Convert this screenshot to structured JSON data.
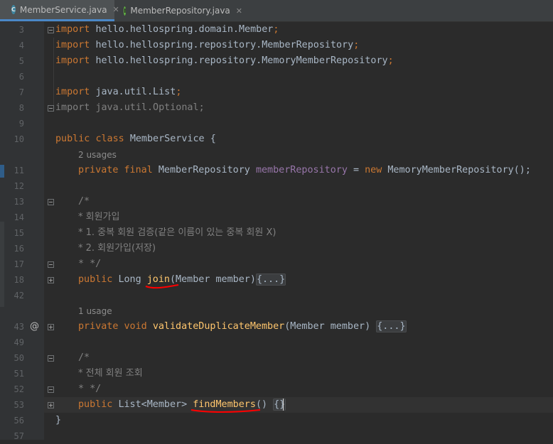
{
  "tabs": [
    {
      "label": "MemberService.java",
      "icon": "class-icon",
      "icon_letter": "C",
      "icon_color": "#3e86a0",
      "active": true
    },
    {
      "label": "MemberRepository.java",
      "icon": "interface-icon",
      "icon_letter": "I",
      "icon_color": "#62b543",
      "active": false
    }
  ],
  "close_glyph": "✕",
  "code_lines": [
    {
      "ln": "3",
      "text": "import hello.hellospring.domain.Member;"
    },
    {
      "ln": "4",
      "text": "import hello.hellospring.repository.MemberRepository;"
    },
    {
      "ln": "5",
      "text": "import hello.hellospring.repository.MemoryMemberRepository;"
    },
    {
      "ln": "6",
      "text": ""
    },
    {
      "ln": "7",
      "text": "import java.util.List;"
    },
    {
      "ln": "8",
      "text": "import java.util.Optional;"
    },
    {
      "ln": "9",
      "text": ""
    },
    {
      "ln": "10",
      "text": "public class MemberService {"
    },
    {
      "ln": "11",
      "text": "    private final MemberRepository memberRepository = new MemoryMemberRepository();",
      "hint": "2 usages"
    },
    {
      "ln": "12",
      "text": ""
    },
    {
      "ln": "13",
      "text": "    /*"
    },
    {
      "ln": "14",
      "text": "    * 회원가입"
    },
    {
      "ln": "15",
      "text": "    * 1. 중복 회원 검증(같은 이름이 있는 중복 회원 X)"
    },
    {
      "ln": "16",
      "text": "    * 2. 회원가입(저장)"
    },
    {
      "ln": "17",
      "text": "    * */"
    },
    {
      "ln": "18",
      "text": "    public Long join(Member member){...}"
    },
    {
      "ln": "42",
      "text": ""
    },
    {
      "ln": "43",
      "text": "    private void validateDuplicateMember(Member member) {...}",
      "hint": "1 usage",
      "gutter_mark": "@"
    },
    {
      "ln": "49",
      "text": ""
    },
    {
      "ln": "50",
      "text": "    /*"
    },
    {
      "ln": "51",
      "text": "    * 전체 회원 조회"
    },
    {
      "ln": "52",
      "text": "    * */"
    },
    {
      "ln": "53",
      "text": "    public List<Member> findMembers() {}"
    },
    {
      "ln": "56",
      "text": "}"
    },
    {
      "ln": "57",
      "text": ""
    }
  ],
  "tokens": {
    "kw_import": "import",
    "pkg_member": "hello.hellospring.domain.Member",
    "pkg_memberrepo": "hello.hellospring.repository.MemberRepository",
    "pkg_memoryrepo": "hello.hellospring.repository.MemoryMemberRepository",
    "pkg_list": "java.util.List",
    "pkg_optional": "java.util.Optional",
    "semi": ";",
    "kw_public": "public",
    "kw_class": "class",
    "cls_name": "MemberService",
    "open_brace": "{",
    "close_brace": "}",
    "kw_private": "private",
    "kw_final": "final",
    "type_memberrepo": "MemberRepository",
    "fld_name": "memberRepository",
    "assign": "=",
    "kw_new": "new",
    "ctor": "MemoryMemberRepository();",
    "cm_open": "/*",
    "cm_14": "* 회원가입",
    "cm_15": "* 1. 중복 회원 검증(같은 이름이 있는 중복 회원 X)",
    "cm_16": "* 2. 회원가입(저장)",
    "cm_close": "* */",
    "type_long": "Long",
    "fn_join": "join",
    "params_member": "(Member member)",
    "folded": "{...}",
    "kw_void": "void",
    "fn_validate": "validateDuplicateMember",
    "cm_51": "* 전체 회원 조회",
    "type_list": "List<Member>",
    "fn_find": "findMembers",
    "empty_parens": "()",
    "empty_body": "{}"
  },
  "colors": {
    "background": "#2b2b2b",
    "keyword": "#cc7832",
    "field": "#9876aa",
    "method": "#ffc66d",
    "comment": "#808080",
    "text": "#a9b7c6",
    "annotation_underline": "#ff0000"
  }
}
